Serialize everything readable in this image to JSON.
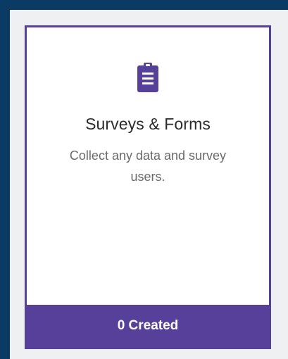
{
  "card": {
    "icon": "clipboard-list-icon",
    "title": "Surveys & Forms",
    "description": "Collect any data and survey users.",
    "footer_label": "0 Created"
  },
  "colors": {
    "background": "#0b3a63",
    "panel": "#eef0f2",
    "accent": "#574099",
    "card": "#ffffff"
  }
}
